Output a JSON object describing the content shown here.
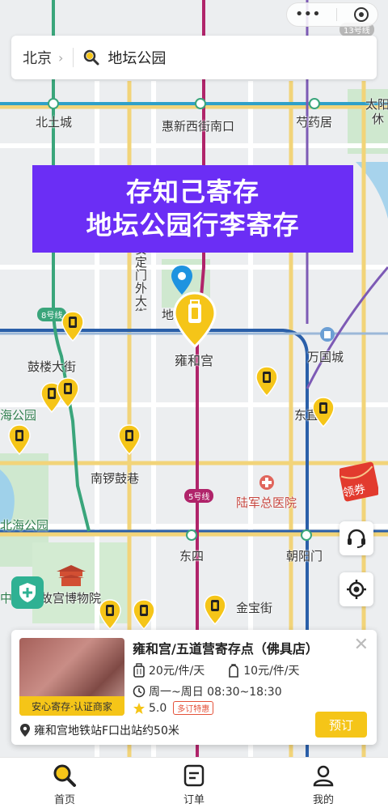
{
  "top_capsule": {
    "dots_icon": "more-dots-icon",
    "close_icon": "close-circle-icon"
  },
  "search": {
    "city": "北京",
    "keyword": "地坛公园"
  },
  "banner": {
    "line1": "存知己寄存",
    "line2": "地坛公园行李寄存"
  },
  "map": {
    "labels": {
      "beitucheng": "北土城",
      "huixinxijie": "惠新西街南口",
      "shaoyaoju": "芍药居",
      "taiyang": "太阳",
      "xiu": "休",
      "andingmen": "安定门外大街",
      "di": "地",
      "yonghegong": "雍和宫",
      "wanguocheng": "万国城",
      "gulou": "鼓楼大街",
      "haigongyuan": "海公园",
      "dong": "东直",
      "nanluoguxiang": "南锣鼓巷",
      "lujun": "陆军总医院",
      "beihai": "北海公园",
      "dongsi": "东四",
      "chaoyangmen": "朝阳门",
      "zhonghai": "中海",
      "gugong": "故宫博物院",
      "jinbaojie": "金宝街",
      "line8": "8号线",
      "line5": "5号线",
      "line13": "13号线"
    },
    "colors": {
      "line8": "#3aa57b",
      "line5": "#b0246a",
      "line2": "#2a5fa9",
      "line10": "#2fa0c9",
      "pin": "#f5c518"
    }
  },
  "side_buttons": {
    "service_icon": "headset-icon",
    "locate_icon": "locate-target-icon",
    "coupon": "领券",
    "shield_icon": "shield-plus-icon"
  },
  "card": {
    "title": "雍和宫/五道营寄存点（佛具店）",
    "badge": "安心寄存·认证商家",
    "price_big": "20元/件/天",
    "price_small": "10元/件/天",
    "hours": "周一~周日 08:30~18:30",
    "rating": "5.0",
    "deal": "多订特惠",
    "book_label": "预订",
    "address": "雍和宫地铁站F口出站约50米"
  },
  "tabs": [
    {
      "label": "首页",
      "icon": "search-icon"
    },
    {
      "label": "订单",
      "icon": "order-icon"
    },
    {
      "label": "我的",
      "icon": "user-icon"
    }
  ]
}
